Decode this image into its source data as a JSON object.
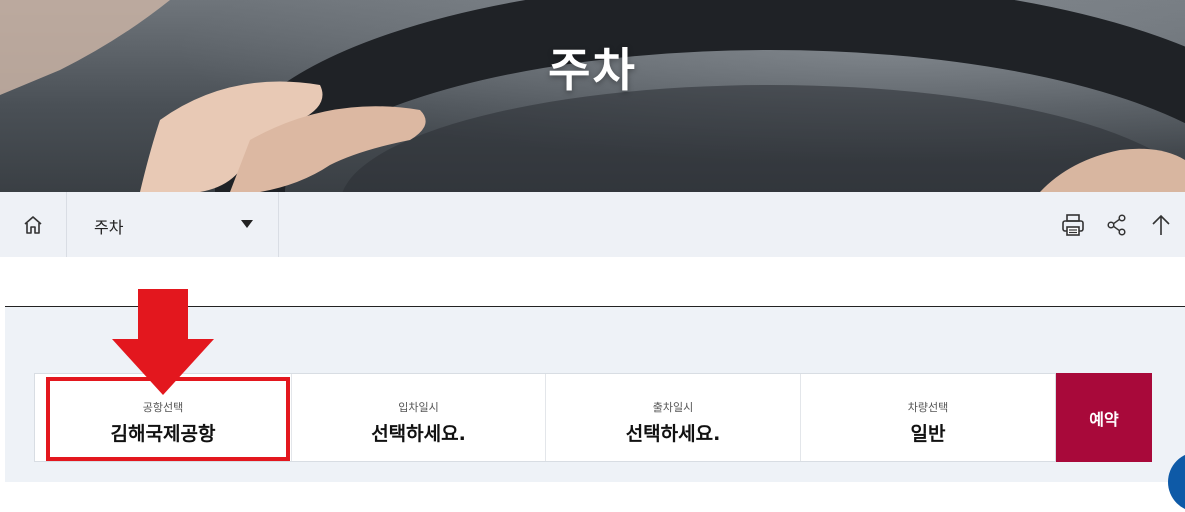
{
  "hero": {
    "title": "주차"
  },
  "navbar": {
    "home_icon": "home-icon",
    "select_label": "주차",
    "tools": [
      "print-icon",
      "share-icon",
      "arrow-up-icon"
    ]
  },
  "search_form": {
    "fields": [
      {
        "label": "공항선택",
        "value": "김해국제공항"
      },
      {
        "label": "입차일시",
        "value": "선택하세요."
      },
      {
        "label": "출차일시",
        "value": "선택하세요."
      },
      {
        "label": "차량선택",
        "value": "일반"
      }
    ],
    "submit_label": "예약"
  },
  "annotation": {
    "highlight_color": "#e3171e",
    "arrow_color": "#e3171e"
  },
  "colors": {
    "accent": "#a8093a",
    "panel_bg": "#eef2f7",
    "nav_bg": "#eef1f6",
    "chat": "#0e5aa7"
  }
}
